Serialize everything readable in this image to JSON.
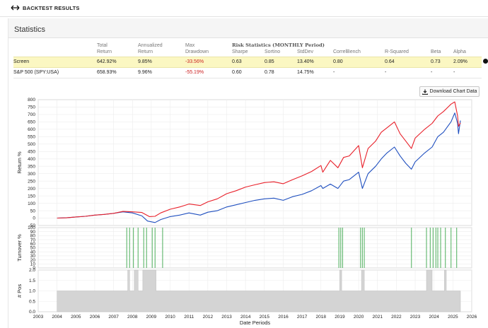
{
  "header": {
    "back_label": "BACKTEST RESULTS",
    "back_icon": "double-arrow-left-right-icon"
  },
  "statistics": {
    "title": "Statistics",
    "columns_row1": {
      "total": "Total",
      "annualized": "Annualized",
      "max": "Max",
      "risk_stats": "Risk Statistics (MONTHLY Period)"
    },
    "columns_row2": {
      "return": "Return",
      "annualized_return": "Return",
      "drawdown": "Drawdown",
      "sharpe": "Sharpe",
      "sortino": "Sortino",
      "stddev": "StdDev",
      "correlbench": "CorrelBench",
      "rsquared": "R-Squared",
      "beta": "Beta",
      "alpha": "Alpha"
    },
    "rows": [
      {
        "name": "Screen",
        "total_return": "642.92%",
        "annualized_return": "9.85%",
        "max_drawdown": "-33.56%",
        "sharpe": "0.63",
        "sortino": "0.85",
        "stddev": "13.40%",
        "correlbench": "0.80",
        "rsquared": "0.64",
        "beta": "0.73",
        "alpha": "2.09%"
      },
      {
        "name": "S&P 500 (SPY:USA)",
        "total_return": "658.93%",
        "annualized_return": "9.96%",
        "max_drawdown": "-55.19%",
        "sharpe": "0.60",
        "sortino": "0.78",
        "stddev": "14.75%",
        "correlbench": "-",
        "rsquared": "-",
        "beta": "-",
        "alpha": "-"
      }
    ]
  },
  "download_button": {
    "label": "Download Chart Data",
    "icon": "download-icon"
  },
  "chart_data": [
    {
      "type": "line",
      "ylabel": "Return %",
      "ylim": [
        -50,
        800
      ],
      "yticks": [
        "800",
        "750",
        "700",
        "650",
        "600",
        "550",
        "500",
        "450",
        "400",
        "350",
        "300",
        "250",
        "200",
        "150",
        "100",
        "50",
        "0",
        "-50"
      ],
      "ytick_values": [
        800,
        750,
        700,
        650,
        600,
        550,
        500,
        450,
        400,
        350,
        300,
        250,
        200,
        150,
        100,
        50,
        0,
        -50
      ],
      "grid": true,
      "colors": {
        "screen": "#e8202a",
        "benchmark": "#1f4fbf"
      },
      "series_screen": [
        [
          2004.0,
          0
        ],
        [
          2004.5,
          2
        ],
        [
          2005.0,
          8
        ],
        [
          2005.5,
          12
        ],
        [
          2006.0,
          20
        ],
        [
          2006.5,
          25
        ],
        [
          2007.0,
          32
        ],
        [
          2007.5,
          45
        ],
        [
          2008.0,
          42
        ],
        [
          2008.5,
          38
        ],
        [
          2008.9,
          10
        ],
        [
          2009.2,
          12
        ],
        [
          2009.5,
          35
        ],
        [
          2010.0,
          60
        ],
        [
          2010.5,
          75
        ],
        [
          2011.0,
          95
        ],
        [
          2011.6,
          85
        ],
        [
          2012.0,
          110
        ],
        [
          2012.5,
          130
        ],
        [
          2013.0,
          165
        ],
        [
          2013.5,
          185
        ],
        [
          2014.0,
          210
        ],
        [
          2014.5,
          225
        ],
        [
          2015.0,
          240
        ],
        [
          2015.5,
          245
        ],
        [
          2016.0,
          232
        ],
        [
          2016.5,
          260
        ],
        [
          2017.0,
          285
        ],
        [
          2017.5,
          315
        ],
        [
          2018.0,
          355
        ],
        [
          2018.1,
          310
        ],
        [
          2018.5,
          390
        ],
        [
          2018.9,
          340
        ],
        [
          2019.2,
          410
        ],
        [
          2019.5,
          420
        ],
        [
          2020.0,
          490
        ],
        [
          2020.2,
          340
        ],
        [
          2020.5,
          470
        ],
        [
          2020.9,
          520
        ],
        [
          2021.2,
          580
        ],
        [
          2021.5,
          610
        ],
        [
          2021.9,
          650
        ],
        [
          2022.2,
          570
        ],
        [
          2022.5,
          520
        ],
        [
          2022.8,
          470
        ],
        [
          2023.0,
          540
        ],
        [
          2023.5,
          600
        ],
        [
          2023.9,
          640
        ],
        [
          2024.2,
          690
        ],
        [
          2024.5,
          720
        ],
        [
          2024.9,
          770
        ],
        [
          2025.1,
          785
        ],
        [
          2025.25,
          690
        ],
        [
          2025.3,
          620
        ],
        [
          2025.4,
          643
        ]
      ],
      "series_benchmark": [
        [
          2004.0,
          0
        ],
        [
          2004.5,
          2
        ],
        [
          2005.0,
          8
        ],
        [
          2005.5,
          12
        ],
        [
          2006.0,
          20
        ],
        [
          2006.5,
          25
        ],
        [
          2007.0,
          32
        ],
        [
          2007.5,
          42
        ],
        [
          2008.0,
          35
        ],
        [
          2008.5,
          15
        ],
        [
          2008.8,
          -20
        ],
        [
          2009.2,
          -30
        ],
        [
          2009.5,
          -10
        ],
        [
          2010.0,
          10
        ],
        [
          2010.5,
          20
        ],
        [
          2011.0,
          35
        ],
        [
          2011.6,
          20
        ],
        [
          2012.0,
          40
        ],
        [
          2012.5,
          50
        ],
        [
          2013.0,
          75
        ],
        [
          2013.5,
          90
        ],
        [
          2014.0,
          105
        ],
        [
          2014.5,
          120
        ],
        [
          2015.0,
          130
        ],
        [
          2015.5,
          135
        ],
        [
          2016.0,
          120
        ],
        [
          2016.5,
          145
        ],
        [
          2017.0,
          160
        ],
        [
          2017.5,
          185
        ],
        [
          2018.0,
          220
        ],
        [
          2018.1,
          200
        ],
        [
          2018.5,
          230
        ],
        [
          2018.9,
          200
        ],
        [
          2019.2,
          250
        ],
        [
          2019.5,
          260
        ],
        [
          2020.0,
          310
        ],
        [
          2020.2,
          200
        ],
        [
          2020.5,
          300
        ],
        [
          2020.9,
          350
        ],
        [
          2021.2,
          400
        ],
        [
          2021.5,
          440
        ],
        [
          2021.9,
          480
        ],
        [
          2022.2,
          420
        ],
        [
          2022.5,
          370
        ],
        [
          2022.8,
          330
        ],
        [
          2023.0,
          380
        ],
        [
          2023.5,
          440
        ],
        [
          2023.9,
          480
        ],
        [
          2024.2,
          550
        ],
        [
          2024.5,
          580
        ],
        [
          2024.9,
          650
        ],
        [
          2025.1,
          710
        ],
        [
          2025.25,
          640
        ],
        [
          2025.3,
          570
        ],
        [
          2025.4,
          659
        ]
      ]
    },
    {
      "type": "bar",
      "ylabel": "Turnover %",
      "ylim": [
        0,
        100
      ],
      "yticks": [
        "100",
        "90",
        "80",
        "70",
        "60",
        "50",
        "40",
        "30",
        "20",
        "10",
        "0"
      ],
      "ytick_values": [
        100,
        90,
        80,
        70,
        60,
        50,
        40,
        30,
        20,
        10,
        0
      ],
      "color": "#3aa64a",
      "x": [
        2007.7,
        2007.85,
        2008.05,
        2008.3,
        2008.6,
        2008.75,
        2009.05,
        2009.2,
        2009.6,
        2018.95,
        2019.05,
        2019.15,
        2020.1,
        2020.2,
        2020.3,
        2022.8,
        2023.6,
        2023.8,
        2023.95,
        2024.1,
        2024.2,
        2024.35,
        2024.6,
        2024.9,
        2025.2
      ],
      "values": [
        100,
        100,
        100,
        100,
        100,
        100,
        100,
        100,
        100,
        100,
        100,
        100,
        100,
        100,
        100,
        100,
        100,
        100,
        100,
        100,
        100,
        100,
        100,
        100,
        100
      ]
    },
    {
      "type": "area",
      "ylabel": "# Pos",
      "xlabel": "Date Periods",
      "ylim": [
        0,
        2.0
      ],
      "yticks": [
        "2.0",
        "1.5",
        "1.0",
        "0.5",
        "0.0"
      ],
      "ytick_values": [
        2.0,
        1.5,
        1.0,
        0.5,
        0.0
      ],
      "xticks": [
        "2003",
        "2004",
        "2005",
        "2006",
        "2007",
        "2008",
        "2009",
        "2010",
        "2011",
        "2012",
        "2013",
        "2014",
        "2015",
        "2016",
        "2017",
        "2018",
        "2019",
        "2020",
        "2021",
        "2022",
        "2023",
        "2024",
        "2025",
        "2026"
      ],
      "xtick_values": [
        2003,
        2004,
        2005,
        2006,
        2007,
        2008,
        2009,
        2010,
        2011,
        2012,
        2013,
        2014,
        2015,
        2016,
        2017,
        2018,
        2019,
        2020,
        2021,
        2022,
        2023,
        2024,
        2025,
        2026
      ],
      "color": "#d4d4d4",
      "segments": [
        [
          2004.0,
          1
        ],
        [
          2007.75,
          1
        ],
        [
          2007.75,
          2
        ],
        [
          2007.85,
          2
        ],
        [
          2007.85,
          1
        ],
        [
          2008.1,
          1
        ],
        [
          2008.1,
          2
        ],
        [
          2008.3,
          2
        ],
        [
          2008.3,
          1
        ],
        [
          2008.55,
          1
        ],
        [
          2008.55,
          2
        ],
        [
          2009.25,
          2
        ],
        [
          2009.25,
          1
        ],
        [
          2019.0,
          1
        ],
        [
          2019.0,
          2
        ],
        [
          2019.1,
          2
        ],
        [
          2019.1,
          1
        ],
        [
          2020.15,
          1
        ],
        [
          2020.15,
          2
        ],
        [
          2020.3,
          2
        ],
        [
          2020.3,
          1
        ],
        [
          2023.6,
          1
        ],
        [
          2023.6,
          2
        ],
        [
          2023.9,
          2
        ],
        [
          2023.9,
          1
        ],
        [
          2024.55,
          1
        ],
        [
          2024.55,
          2
        ],
        [
          2024.65,
          2
        ],
        [
          2024.65,
          1
        ],
        [
          2025.4,
          1
        ]
      ]
    }
  ]
}
